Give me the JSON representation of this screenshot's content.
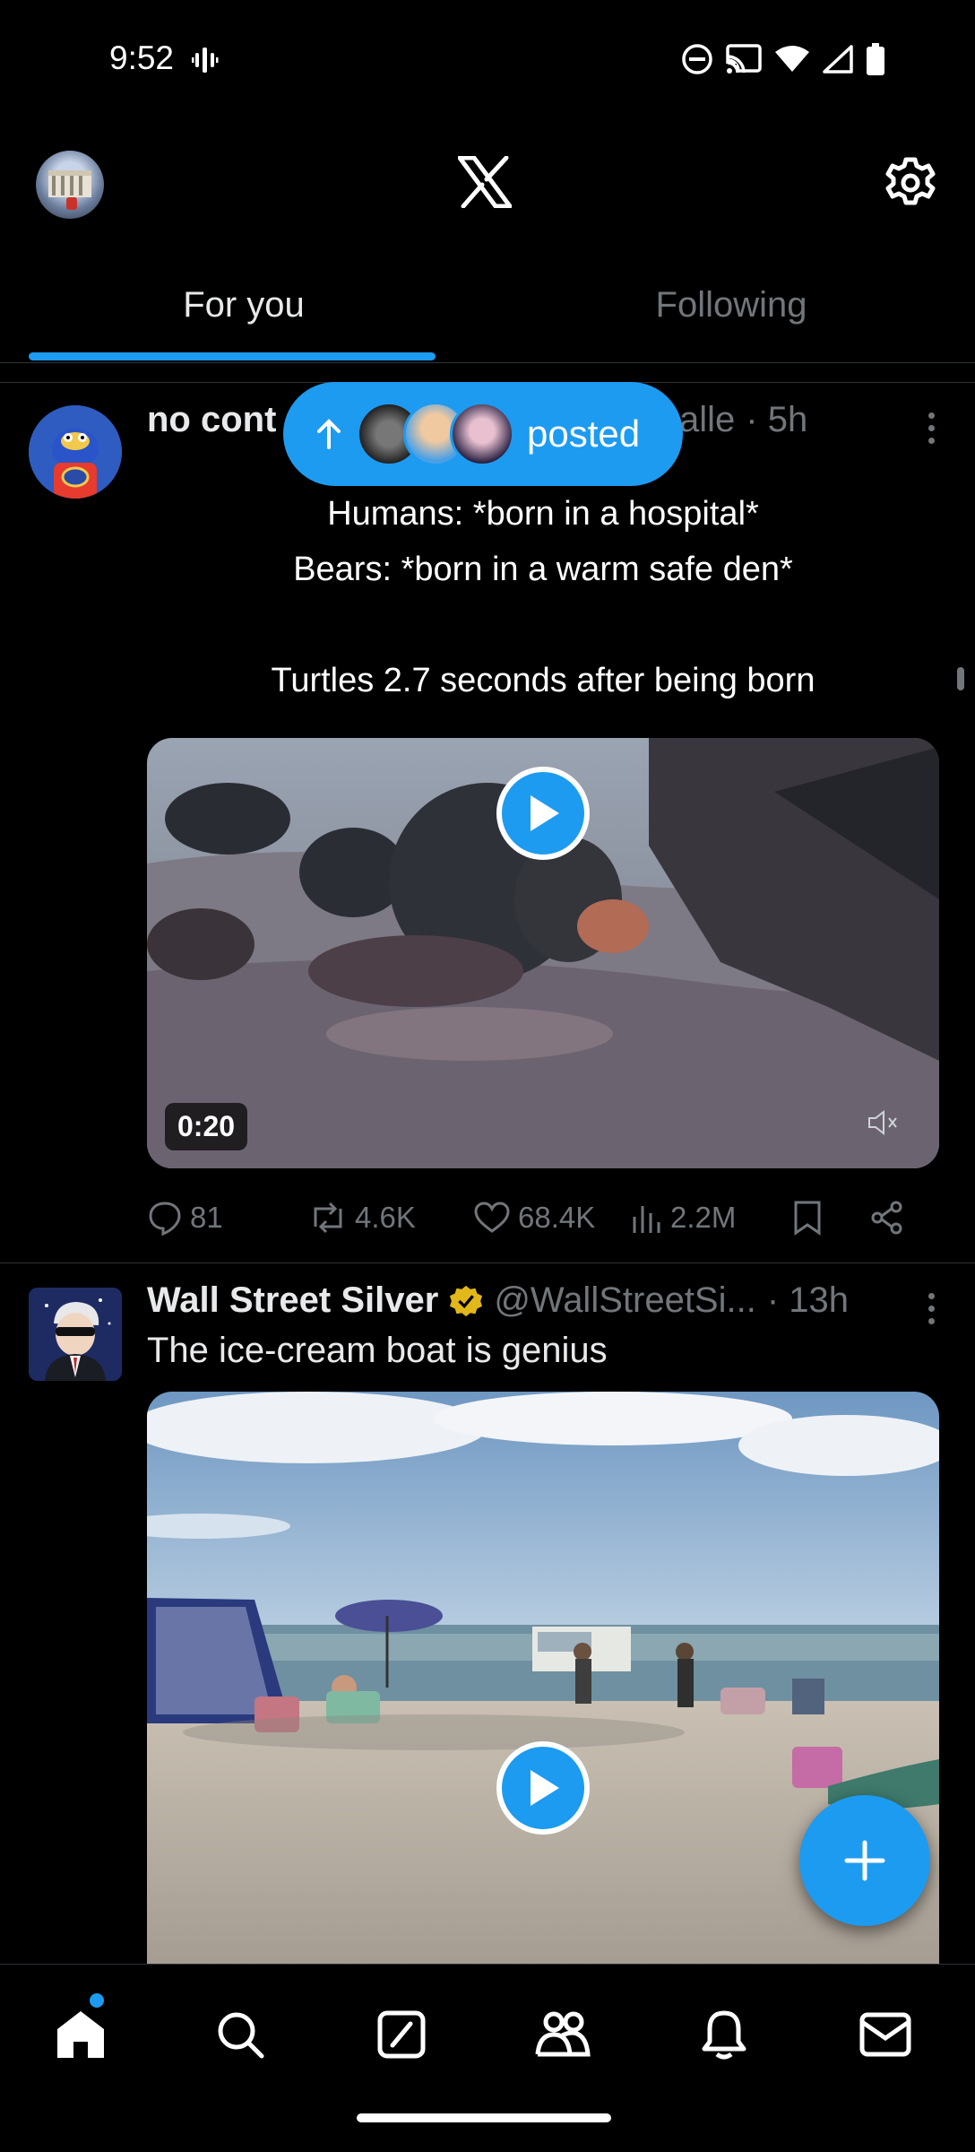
{
  "status_bar": {
    "time": "9:52"
  },
  "tabs": [
    {
      "label": "For you"
    },
    {
      "label": "Following"
    }
  ],
  "posts": [
    {
      "name": "no cont",
      "handle_fragment": "alle",
      "time": "· 5h",
      "image_text_lines": [
        "Humans: *born in a hospital*",
        "Bears: *born in a warm safe den*",
        "",
        "Turtles 2.7 seconds after being born"
      ],
      "video_duration": "0:20",
      "stats": {
        "replies": "81",
        "reposts": "4.6K",
        "likes": "68.4K",
        "views": "2.2M"
      }
    },
    {
      "name": "Wall Street Silver",
      "handle": "@WallStreetSi...",
      "time": "· 13h",
      "text": "The ice-cream boat is genius",
      "verified_color": "#e2b719"
    }
  ],
  "posted_pill": {
    "label": "posted"
  },
  "colors": {
    "accent": "#1d9bf0",
    "muted": "#71767b",
    "text": "#e7e9ea"
  },
  "icons": {
    "status": [
      "vibrate-icon",
      "do-not-disturb-icon",
      "cast-icon",
      "wifi-icon",
      "signal-icon",
      "battery-icon"
    ],
    "nav": [
      "home-icon",
      "search-icon",
      "grok-icon",
      "communities-icon",
      "notifications-icon",
      "messages-icon"
    ]
  }
}
